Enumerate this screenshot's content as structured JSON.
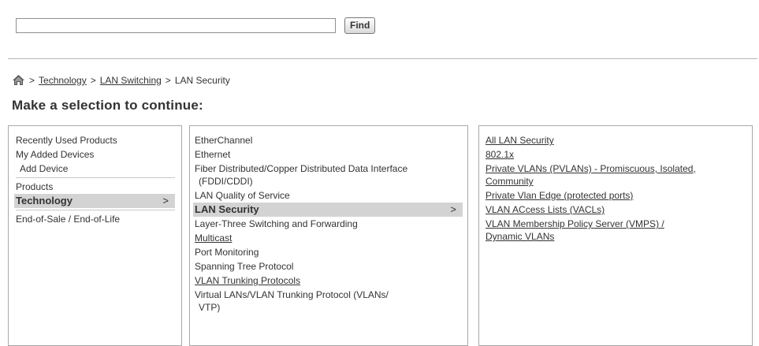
{
  "search": {
    "value": "",
    "placeholder": "",
    "button_label": "Find"
  },
  "breadcrumb": {
    "items": [
      "Technology",
      "LAN Switching",
      "LAN Security"
    ],
    "separator": ">"
  },
  "page_title": "Make a selection to continue:",
  "col1": {
    "recent": "Recently Used Products",
    "my_devices": "My Added Devices",
    "add_device": "Add Device",
    "products": "Products",
    "technology": "Technology",
    "eos": "End-of-Sale / End-of-Life",
    "chevron": ">"
  },
  "col2": {
    "items": [
      "EtherChannel",
      "Ethernet",
      "Fiber Distributed/Copper Distributed Data Interface",
      "(FDDI/CDDI)",
      "LAN Quality of Service",
      "LAN Security",
      "Layer-Three Switching and Forwarding",
      "Multicast",
      "Port Monitoring",
      "Spanning Tree Protocol",
      "VLAN Trunking Protocols",
      "Virtual LANs/VLAN Trunking Protocol (VLANs/",
      "VTP)"
    ],
    "chevron": ">"
  },
  "col3": {
    "items": [
      "All LAN Security",
      "802.1x",
      "Private VLANs (PVLANs) - Promiscuous, Isolated,",
      "Community",
      "Private Vlan Edge (protected ports)",
      "VLAN ACcess Lists (VACLs)",
      "VLAN Membership Policy Server (VMPS) /",
      "Dynamic VLANs"
    ]
  },
  "colors": {
    "selected_bg": "#d3d3d3",
    "text": "#333333",
    "border": "#a9a9a9"
  },
  "icons": {
    "home": "home-icon"
  }
}
